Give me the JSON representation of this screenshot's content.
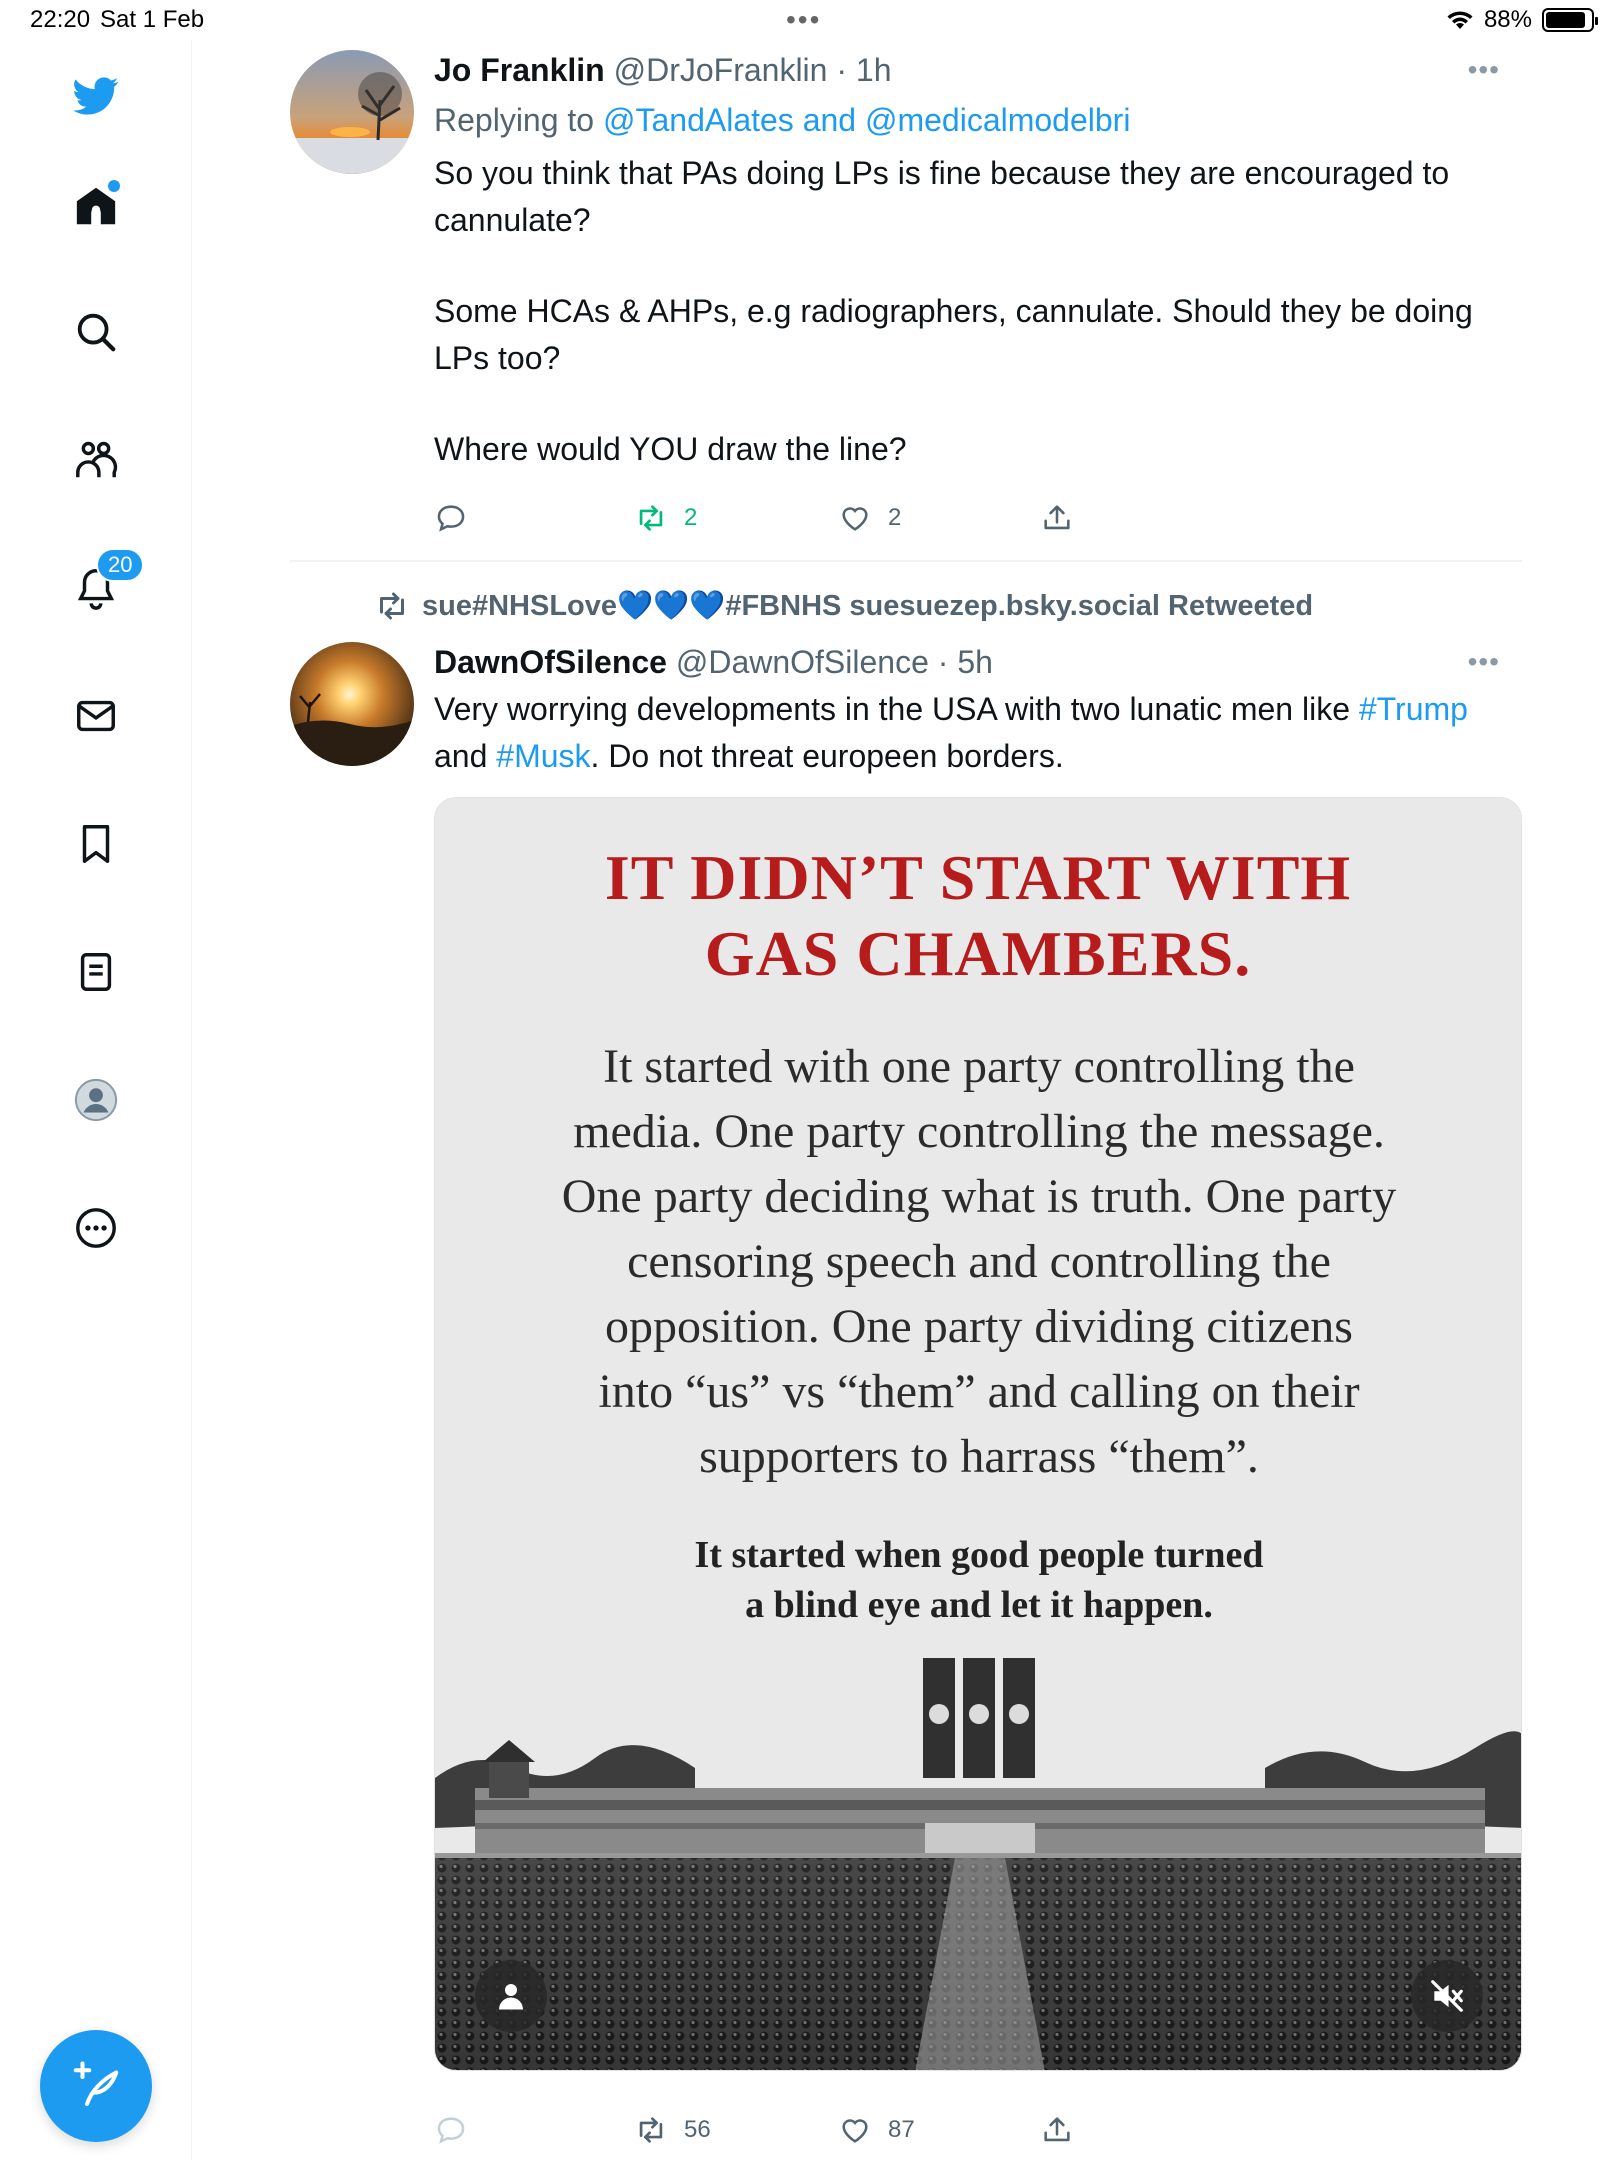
{
  "status_bar": {
    "time": "22:20",
    "date": "Sat 1 Feb",
    "battery": "88%",
    "battery_level": 0.88
  },
  "sidebar": {
    "notifications_badge": "20"
  },
  "tweets": [
    {
      "name": "Jo Franklin",
      "handle": "@DrJoFranklin",
      "time": "1h",
      "replying_prefix": "Replying to",
      "reply_user_1": "@TandAlates",
      "reply_and": "and",
      "reply_user_2": "@medicalmodelbri",
      "paragraphs": [
        "So you think that PAs doing LPs is fine because they are encouraged to cannulate?",
        "Some HCAs & AHPs, e.g radiographers, cannulate. Should they be doing LPs too?",
        "Where would YOU draw the line?"
      ],
      "retweets": "2",
      "likes": "2"
    },
    {
      "retweeted_by": "sue#NHSLove",
      "retweeted_hearts": "💙💙💙",
      "retweeted_suffix": "#FBNHS suesuezep.bsky.social Retweeted",
      "name": "DawnOfSilence",
      "handle": "@DawnOfSilence",
      "time": "5h",
      "text_1": "Very worrying developments in the USA with two lunatic men like",
      "hashtag_1": "#Trump",
      "text_2": "and",
      "hashtag_2": "#Musk",
      "text_3": ". Do not threat europeen borders.",
      "media": {
        "title_line_1": "IT DIDN’T START WITH",
        "title_line_2": "GAS CHAMBERS.",
        "body_lines": [
          "It started with one party controlling the",
          "media. One party controlling the message.",
          "One party deciding what is truth. One party",
          "censoring speech and controlling the",
          "opposition. One party dividing citizens",
          "into “us” vs “them” and calling on their",
          "supporters to harrass “them”."
        ],
        "foot_line_1": "It started when good people turned",
        "foot_line_2": "a blind eye and let it happen."
      },
      "retweets": "56",
      "likes": "87"
    }
  ],
  "colors": {
    "accent": "#1d9bf0",
    "secondary_text": "#536471",
    "retweet_green": "#00ba7c",
    "poster_red": "#b71c1c"
  },
  "icons": [
    "twitter-logo-icon",
    "home-icon",
    "search-icon",
    "communities-icon",
    "notifications-icon",
    "messages-icon",
    "bookmarks-icon",
    "lists-icon",
    "profile-icon",
    "more-icon",
    "compose-icon",
    "reply-icon",
    "retweet-icon",
    "like-icon",
    "share-icon",
    "person-tag-icon",
    "mute-icon"
  ]
}
